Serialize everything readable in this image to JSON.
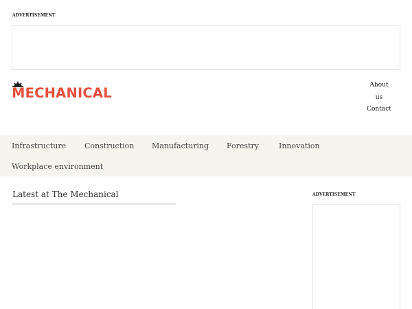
{
  "top_ad": {
    "label": "ADVERTISEMENT"
  },
  "logo": {
    "text": "MECHANICAL",
    "color": "#e4503f",
    "icon": "gear-icon"
  },
  "header_nav": {
    "about": "About us",
    "contact": "Contact"
  },
  "main_nav": {
    "items": [
      {
        "label": "Infrastructure"
      },
      {
        "label": "Construction"
      },
      {
        "label": "Manufacturing"
      },
      {
        "label": "Forestry"
      },
      {
        "label": "Innovation"
      },
      {
        "label": "Workplace environment"
      }
    ]
  },
  "latest": {
    "title": "Latest at The Mechanical"
  },
  "side_ad": {
    "label": "ADVERTISEMENT"
  },
  "colors": {
    "nav_bg": "#f5f4ef",
    "brand_red": "#e4503f",
    "rule": "#e2e2e2"
  }
}
